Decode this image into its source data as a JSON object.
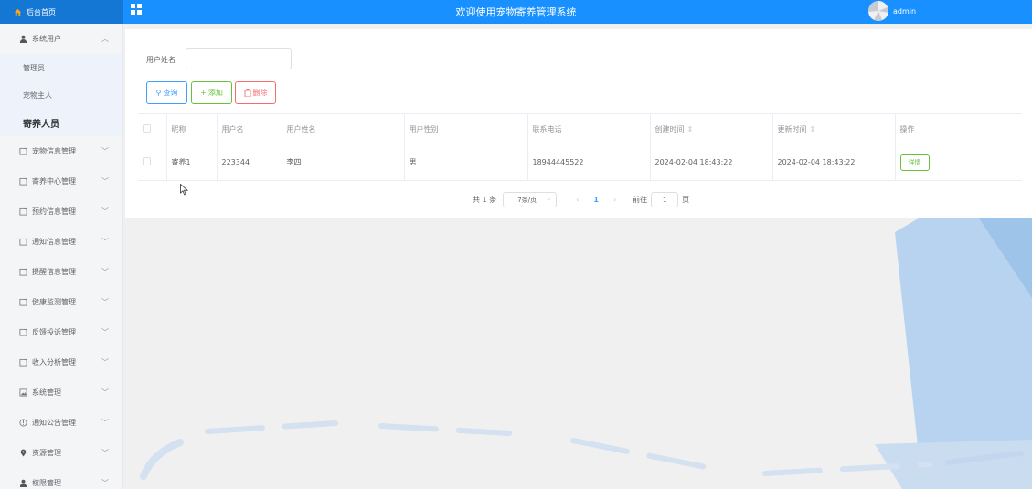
{
  "header": {
    "home_label": "后台首页",
    "title": "欢迎使用宠物寄养管理系统",
    "user_name": "admin"
  },
  "sidebar": {
    "groups": [
      {
        "label": "系统用户",
        "icon": "user-icon",
        "expanded": true
      },
      {
        "label": "宠物信息管理",
        "icon": "doc-icon"
      },
      {
        "label": "寄养中心管理",
        "icon": "doc-icon"
      },
      {
        "label": "预约信息管理",
        "icon": "doc-icon"
      },
      {
        "label": "通知信息管理",
        "icon": "doc-icon"
      },
      {
        "label": "提醒信息管理",
        "icon": "doc-icon"
      },
      {
        "label": "健康监测管理",
        "icon": "doc-icon"
      },
      {
        "label": "反馈投诉管理",
        "icon": "doc-icon"
      },
      {
        "label": "收入分析管理",
        "icon": "doc-icon"
      },
      {
        "label": "系统管理",
        "icon": "image-icon"
      },
      {
        "label": "通知公告管理",
        "icon": "info-icon"
      },
      {
        "label": "资源管理",
        "icon": "location-icon"
      },
      {
        "label": "权限管理",
        "icon": "user-icon"
      }
    ],
    "sub_items": [
      {
        "label": "管理员"
      },
      {
        "label": "宠物主人"
      },
      {
        "label": "寄养人员",
        "active": true
      }
    ]
  },
  "search": {
    "label": "用户姓名",
    "value": "",
    "placeholder": ""
  },
  "toolbar": {
    "query_label": "查询",
    "add_label": "添加",
    "delete_label": "删除"
  },
  "table": {
    "columns": [
      "昵称",
      "用户名",
      "用户姓名",
      "用户性别",
      "联系电话",
      "创建时间",
      "更新时间",
      "操作"
    ],
    "rows": [
      {
        "nickname": "寄养1",
        "username": "223344",
        "realname": "李四",
        "gender": "男",
        "phone": "18944445522",
        "created": "2024-02-04 18:43:22",
        "updated": "2024-02-04 18:43:22",
        "action": "详情"
      }
    ]
  },
  "pagination": {
    "total": "共 1 条",
    "page_size": "7条/页",
    "current_page": "1",
    "goto_label": "前往",
    "goto_value": "1",
    "page_suffix": "页"
  },
  "colors": {
    "header_bg": "#1890ff",
    "primary": "#409eff",
    "success": "#67c23a",
    "danger": "#f56c6c"
  }
}
